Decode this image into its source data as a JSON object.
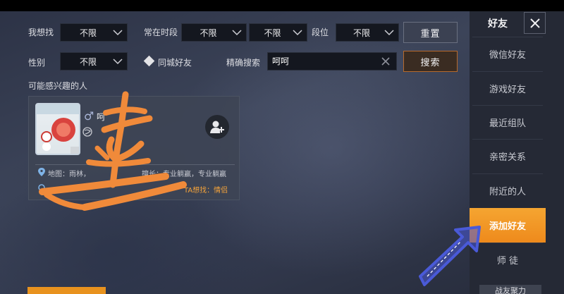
{
  "filters": {
    "looking_for_label": "我想找",
    "looking_for_value": "不限",
    "active_time_label": "常在时段",
    "active_time_from": "不限",
    "active_time_to": "不限",
    "rank_label": "段位",
    "rank_value": "不限",
    "reset_label": "重置",
    "gender_label": "性别",
    "gender_value": "不限",
    "same_city_label": "同城好友",
    "exact_search_label": "精确搜索",
    "exact_search_value": "呵呵",
    "search_label": "搜索"
  },
  "section_title": "可能感兴趣的人",
  "card": {
    "name_partial": "呵",
    "location_partial": "地图：雨林，",
    "expertise": "擅长：专业躺赢，专业躺赢",
    "wants": "TA想找：情侣",
    "gender_symbol": "♂"
  },
  "sidebar": {
    "title": "好友",
    "items": [
      {
        "label": "微信好友"
      },
      {
        "label": "游戏好友"
      },
      {
        "label": "最近组队"
      },
      {
        "label": "亲密关系"
      },
      {
        "label": "附近的人"
      },
      {
        "label": "添加好友"
      },
      {
        "label": "师 徒"
      }
    ],
    "bottom_label": "战友聚力"
  },
  "colors": {
    "accent_orange": "#f09a25",
    "annotation_orange": "#f08a3a",
    "annotation_arrow": "#4a5ad8"
  }
}
